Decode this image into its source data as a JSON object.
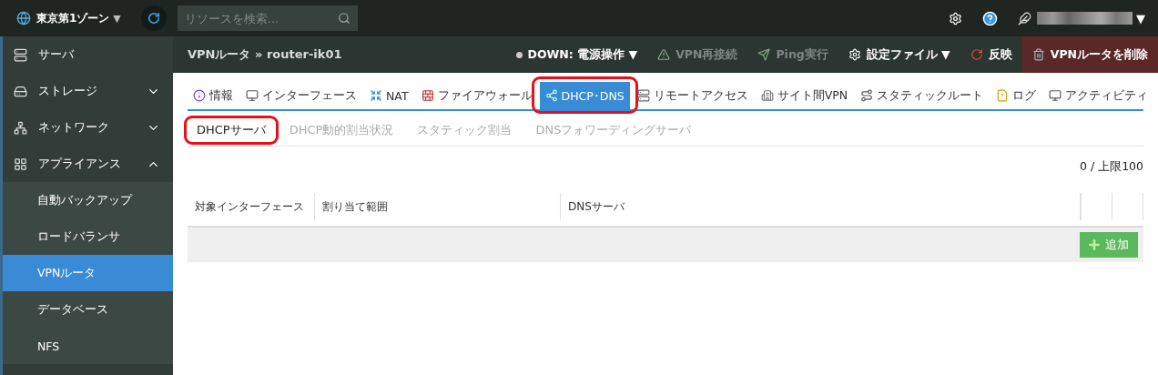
{
  "topbar": {
    "zone": "東京第1ゾーン",
    "zone_caret": "▼",
    "search": {
      "placeholder": "リソースを検索..."
    },
    "user_caret": "▼"
  },
  "sidebar": {
    "items": [
      {
        "label": "サーバ",
        "selected": false
      },
      {
        "label": "ストレージ",
        "selected": false,
        "expanded": false
      },
      {
        "label": "ネットワーク",
        "selected": false,
        "expanded": false
      },
      {
        "label": "アプライアンス",
        "selected": false,
        "expanded": true,
        "children": [
          {
            "label": "自動バックアップ",
            "selected": false
          },
          {
            "label": "ロードバランサ",
            "selected": false
          },
          {
            "label": "VPNルータ",
            "selected": true
          },
          {
            "label": "データベース",
            "selected": false
          },
          {
            "label": "NFS",
            "selected": false
          }
        ]
      }
    ]
  },
  "header": {
    "breadcrumb": "VPNルータ » router-ik01",
    "actions": [
      {
        "kind": "status",
        "label": "DOWN: 電源操作 ▼",
        "disabled": false
      },
      {
        "kind": "warning",
        "label": "VPN再接続",
        "disabled": true
      },
      {
        "kind": "send",
        "label": "Ping実行",
        "disabled": true
      },
      {
        "kind": "gear",
        "label": "設定ファイル ▼",
        "disabled": false
      },
      {
        "kind": "refresh",
        "label": "反映",
        "disabled": false
      },
      {
        "kind": "delete",
        "label": "VPNルータを削除",
        "disabled": false
      }
    ]
  },
  "tabs": [
    {
      "label": "情報",
      "selected": false,
      "highlighted": false
    },
    {
      "label": "インターフェース",
      "selected": false,
      "highlighted": false
    },
    {
      "label": "NAT",
      "selected": false,
      "highlighted": false
    },
    {
      "label": "ファイアウォール",
      "selected": false,
      "highlighted": false
    },
    {
      "label": "DHCP･DNS",
      "selected": true,
      "highlighted": true
    },
    {
      "label": "リモートアクセス",
      "selected": false,
      "highlighted": false
    },
    {
      "label": "サイト間VPN",
      "selected": false,
      "highlighted": false
    },
    {
      "label": "スタティックルート",
      "selected": false,
      "highlighted": false
    },
    {
      "label": "ログ",
      "selected": false,
      "highlighted": false
    },
    {
      "label": "アクティビティ",
      "selected": false,
      "highlighted": false
    }
  ],
  "subtabs": [
    {
      "label": "DHCPサーバ",
      "selected": true,
      "highlighted": true
    },
    {
      "label": "DHCP動的割当状況",
      "selected": false,
      "highlighted": false
    },
    {
      "label": "スタティック割当",
      "selected": false,
      "highlighted": false
    },
    {
      "label": "DNSフォワーディングサーバ",
      "selected": false,
      "highlighted": false
    }
  ],
  "count": "0 / 上限100",
  "table": {
    "columns": [
      "対象インターフェース",
      "割り当て範囲",
      "DNSサーバ"
    ]
  },
  "add_button": "追加"
}
